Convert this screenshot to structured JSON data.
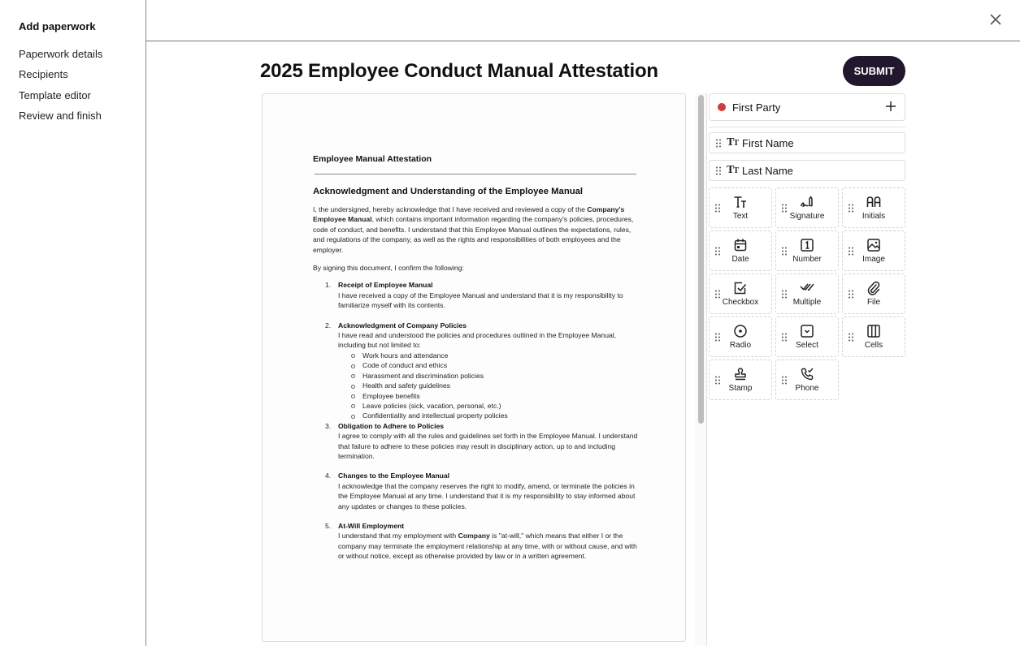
{
  "sidebar": {
    "title": "Add paperwork",
    "items": [
      {
        "label": "Paperwork details"
      },
      {
        "label": "Recipients"
      },
      {
        "label": "Template editor"
      },
      {
        "label": "Review and finish"
      }
    ]
  },
  "header": {
    "close_icon": "close-icon",
    "title": "2025 Employee Conduct Manual Attestation",
    "submit_label": "SUBMIT"
  },
  "document": {
    "heading": "Employee Manual Attestation",
    "subheading": "Acknowledgment and Understanding of the Employee Manual",
    "intro_1": "I, the undersigned, hereby acknowledge that I have received and reviewed a copy of the ",
    "intro_bold": "Company's Employee Manual",
    "intro_2": ", which contains important information regarding the company's policies, procedures, code of conduct, and benefits. I understand that this Employee Manual outlines the expectations, rules, and regulations of the company, as well as the rights and responsibilities of both employees and the employer.",
    "confirm": "By signing this document, I confirm the following:",
    "items": [
      {
        "num": "1.",
        "title": "Receipt of Employee Manual",
        "body": " I have received a copy of the Employee Manual and understand that it is my responsibility to familiarize myself with its contents."
      },
      {
        "num": "2.",
        "title": "Acknowledgment of Company Policies",
        "body": " I have read and understood the policies and procedures outlined in the Employee Manual, including but not limited to:",
        "bullets": [
          "Work hours and attendance",
          "Code of conduct and ethics",
          "Harassment and discrimination policies",
          "Health and safety guidelines",
          "Employee benefits",
          "Leave policies (sick, vacation, personal, etc.)",
          "Confidentiality and intellectual property policies"
        ]
      },
      {
        "num": "3.",
        "title": "Obligation to Adhere to Policies",
        "body": " I agree to comply with all the rules and guidelines set forth in the Employee Manual. I understand that failure to adhere to these policies may result in disciplinary action, up to and including termination."
      },
      {
        "num": "4.",
        "title": "Changes to the Employee Manual",
        "body": " I acknowledge that the company reserves the right to modify, amend, or terminate the policies in the Employee Manual at any time. I understand that it is my responsibility to stay informed about any updates or changes to these policies."
      },
      {
        "num": "5.",
        "title": "At-Will Employment",
        "body_1": " I understand that my employment with ",
        "body_bold": "Company",
        "body_2": " is \"at-will,\" which means that either I or the company may terminate the employment relationship at any time, with or without cause, and with or without notice, except as otherwise provided by law or in a written agreement."
      }
    ]
  },
  "fields_panel": {
    "party": {
      "name": "First Party",
      "color": "#d23b3b",
      "add_icon": "plus-icon"
    },
    "quick_fields": [
      {
        "label": "First Name",
        "icon": "text-icon"
      },
      {
        "label": "Last Name",
        "icon": "text-icon"
      }
    ],
    "field_types": [
      {
        "label": "Text",
        "icon": "text-icon"
      },
      {
        "label": "Signature",
        "icon": "signature-icon"
      },
      {
        "label": "Initials",
        "icon": "initials-icon"
      },
      {
        "label": "Date",
        "icon": "calendar-icon"
      },
      {
        "label": "Number",
        "icon": "number-icon"
      },
      {
        "label": "Image",
        "icon": "image-icon"
      },
      {
        "label": "Checkbox",
        "icon": "checkbox-icon"
      },
      {
        "label": "Multiple",
        "icon": "multiple-check-icon"
      },
      {
        "label": "File",
        "icon": "paperclip-icon"
      },
      {
        "label": "Radio",
        "icon": "radio-icon"
      },
      {
        "label": "Select",
        "icon": "select-icon"
      },
      {
        "label": "Cells",
        "icon": "cells-icon"
      },
      {
        "label": "Stamp",
        "icon": "stamp-icon"
      },
      {
        "label": "Phone",
        "icon": "phone-icon"
      }
    ]
  },
  "colors": {
    "submit_bg": "#23172e",
    "party_dot": "#d23b3b"
  }
}
